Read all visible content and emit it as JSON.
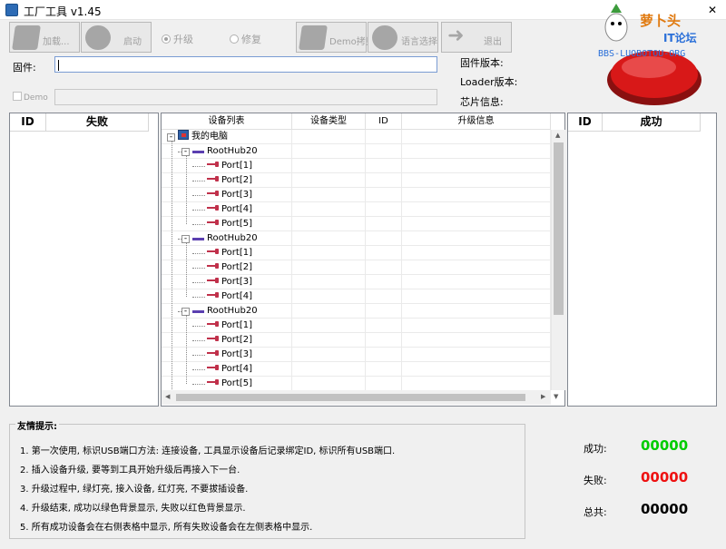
{
  "window": {
    "title": "工厂工具 v1.45",
    "close": "✕"
  },
  "toolbar": {
    "load": "加载...",
    "start": "启动",
    "demo_copy": "Demo拷贝",
    "language": "语言选择",
    "exit": "退出"
  },
  "mode": {
    "upgrade": "升级",
    "repair": "修复",
    "selected": "升级"
  },
  "fields": {
    "firmware_label": "固件:",
    "firmware_value": "",
    "demo_label": "Demo",
    "demo_value": ""
  },
  "info": {
    "firmware_version": "固件版本:",
    "loader_version": "Loader版本:",
    "chip_info": "芯片信息:"
  },
  "logo": {
    "line1": "萝卜头",
    "line2": "IT论坛",
    "line3": "BBS-LUOBOTOU-ORG"
  },
  "fail_table": {
    "col_id": "ID",
    "col_status": "失败"
  },
  "success_table": {
    "col_id": "ID",
    "col_status": "成功"
  },
  "device_table": {
    "columns": [
      "设备列表",
      "设备类型",
      "ID",
      "升级信息"
    ],
    "root": "我的电脑",
    "hubs": [
      {
        "name": "RootHub20",
        "ports": [
          "Port[1]",
          "Port[2]",
          "Port[3]",
          "Port[4]",
          "Port[5]"
        ]
      },
      {
        "name": "RootHub20",
        "ports": [
          "Port[1]",
          "Port[2]",
          "Port[3]",
          "Port[4]"
        ]
      },
      {
        "name": "RootHub20",
        "ports": [
          "Port[1]",
          "Port[2]",
          "Port[3]",
          "Port[4]",
          "Port[5]"
        ]
      }
    ]
  },
  "tips": {
    "title": "友情提示:",
    "items": [
      "1. 第一次使用, 标识USB端口方法: 连接设备, 工具显示设备后记录绑定ID, 标识所有USB端口.",
      "2. 插入设备升级, 要等到工具开始升级后再接入下一台.",
      "3. 升级过程中, 绿灯亮, 接入设备, 红灯亮, 不要拔插设备.",
      "4. 升级结束, 成功以绿色背景显示, 失败以红色背景显示.",
      "5. 所有成功设备会在右侧表格中显示, 所有失败设备会在左侧表格中显示."
    ]
  },
  "stats": {
    "success_label": "成功:",
    "success_value": "00000",
    "fail_label": "失败:",
    "fail_value": "00000",
    "total_label": "总共:",
    "total_value": "00000",
    "success_color": "#00cc00",
    "fail_color": "#ee1111",
    "total_color": "#000000"
  }
}
